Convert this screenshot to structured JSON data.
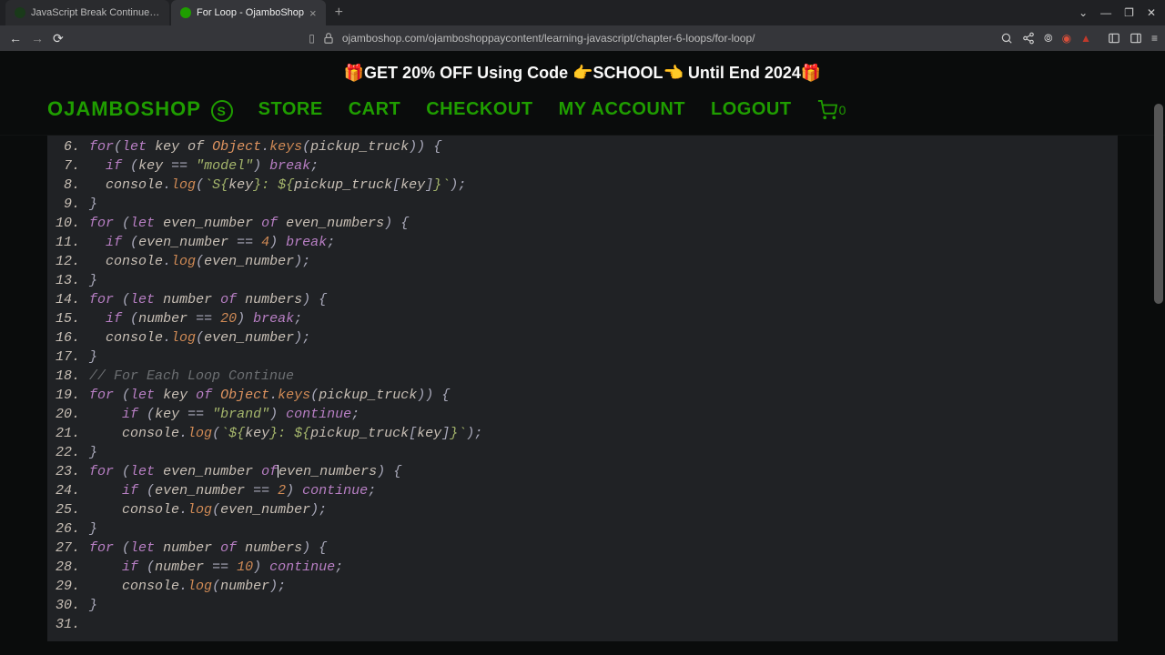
{
  "tabs": [
    {
      "title": "JavaScript Break Continue Loo…",
      "active": false
    },
    {
      "title": "For Loop - OjamboShop",
      "active": true
    }
  ],
  "url": "ojamboshop.com/ojamboshoppaycontent/learning-javascript/chapter-6-loops/for-loop/",
  "promo": "🎁GET 20% OFF Using Code 👉SCHOOL👈 Until End 2024🎁",
  "nav": {
    "brand": "OJAMBOSHOP",
    "store": "STORE",
    "cart": "CART",
    "checkout": "CHECKOUT",
    "account": "MY ACCOUNT",
    "logout": "LOGOUT",
    "cart_count": "0"
  },
  "code": [
    {
      "n": "6.",
      "segs": [
        [
          "kw",
          "for"
        ],
        [
          "punct",
          "("
        ],
        [
          "kw",
          "let"
        ],
        [
          "",
          "",
          " "
        ],
        [
          "",
          "key of "
        ],
        [
          "obj",
          "Object"
        ],
        [
          "punct",
          "."
        ],
        [
          "fn",
          "keys"
        ],
        [
          "punct",
          "("
        ],
        [
          "",
          "pickup_truck"
        ],
        [
          "punct",
          "))"
        ],
        [
          "",
          "",
          " "
        ],
        [
          "punct",
          "{"
        ]
      ]
    },
    {
      "n": "7.",
      "segs": [
        [
          "",
          "  "
        ],
        [
          "kw",
          "if"
        ],
        [
          "",
          "",
          " "
        ],
        [
          "punct",
          "("
        ],
        [
          "",
          "key "
        ],
        [
          "punct",
          "=="
        ],
        [
          "",
          "",
          " "
        ],
        [
          "str",
          "\"model\""
        ],
        [
          "punct",
          ")"
        ],
        [
          "",
          "",
          " "
        ],
        [
          "kw",
          "break"
        ],
        [
          "punct",
          ";"
        ]
      ]
    },
    {
      "n": "8.",
      "segs": [
        [
          "",
          "  "
        ],
        [
          "",
          "console"
        ],
        [
          "punct",
          "."
        ],
        [
          "fn",
          "log"
        ],
        [
          "punct",
          "("
        ],
        [
          "str",
          "`S{"
        ],
        [
          "",
          "key"
        ],
        [
          "str",
          "}: ${"
        ],
        [
          "",
          "pickup_truck"
        ],
        [
          "punct",
          "["
        ],
        [
          "",
          "key"
        ],
        [
          "punct",
          "]"
        ],
        [
          "str",
          "}`"
        ],
        [
          "punct",
          ");"
        ]
      ]
    },
    {
      "n": "9.",
      "segs": [
        [
          "punct",
          "}"
        ]
      ]
    },
    {
      "n": "10.",
      "segs": [
        [
          "kw",
          "for"
        ],
        [
          "",
          "",
          " "
        ],
        [
          "punct",
          "("
        ],
        [
          "kw",
          "let"
        ],
        [
          "",
          "",
          " "
        ],
        [
          "",
          "even_number "
        ],
        [
          "kw",
          "of"
        ],
        [
          "",
          "",
          " "
        ],
        [
          "",
          "even_numbers"
        ],
        [
          "punct",
          ")"
        ],
        [
          "",
          "",
          " "
        ],
        [
          "punct",
          "{"
        ]
      ]
    },
    {
      "n": "11.",
      "segs": [
        [
          "",
          "  "
        ],
        [
          "kw",
          "if"
        ],
        [
          "",
          "",
          " "
        ],
        [
          "punct",
          "("
        ],
        [
          "",
          "even_number "
        ],
        [
          "punct",
          "=="
        ],
        [
          "",
          "",
          " "
        ],
        [
          "num",
          "4"
        ],
        [
          "punct",
          ")"
        ],
        [
          "",
          "",
          " "
        ],
        [
          "kw",
          "break"
        ],
        [
          "punct",
          ";"
        ]
      ]
    },
    {
      "n": "12.",
      "segs": [
        [
          "",
          "  "
        ],
        [
          "",
          "console"
        ],
        [
          "punct",
          "."
        ],
        [
          "fn",
          "log"
        ],
        [
          "punct",
          "("
        ],
        [
          "",
          "even_number"
        ],
        [
          "punct",
          ");"
        ]
      ]
    },
    {
      "n": "13.",
      "segs": [
        [
          "punct",
          "}"
        ]
      ]
    },
    {
      "n": "14.",
      "segs": [
        [
          "kw",
          "for"
        ],
        [
          "",
          "",
          " "
        ],
        [
          "punct",
          "("
        ],
        [
          "kw",
          "let"
        ],
        [
          "",
          "",
          " "
        ],
        [
          "",
          "number "
        ],
        [
          "kw",
          "of"
        ],
        [
          "",
          "",
          " "
        ],
        [
          "",
          "numbers"
        ],
        [
          "punct",
          ")"
        ],
        [
          "",
          "",
          " "
        ],
        [
          "punct",
          "{"
        ]
      ]
    },
    {
      "n": "15.",
      "segs": [
        [
          "",
          "  "
        ],
        [
          "kw",
          "if"
        ],
        [
          "",
          "",
          " "
        ],
        [
          "punct",
          "("
        ],
        [
          "",
          "number "
        ],
        [
          "punct",
          "=="
        ],
        [
          "",
          "",
          " "
        ],
        [
          "num",
          "20"
        ],
        [
          "punct",
          ")"
        ],
        [
          "",
          "",
          " "
        ],
        [
          "kw",
          "break"
        ],
        [
          "punct",
          ";"
        ]
      ]
    },
    {
      "n": "16.",
      "segs": [
        [
          "",
          "  "
        ],
        [
          "",
          "console"
        ],
        [
          "punct",
          "."
        ],
        [
          "fn",
          "log"
        ],
        [
          "punct",
          "("
        ],
        [
          "",
          "even_number"
        ],
        [
          "punct",
          ");"
        ]
      ]
    },
    {
      "n": "17.",
      "segs": [
        [
          "punct",
          "}"
        ]
      ]
    },
    {
      "n": "18.",
      "segs": [
        [
          "comment",
          "// For Each Loop Continue"
        ]
      ]
    },
    {
      "n": "19.",
      "segs": [
        [
          "kw",
          "for"
        ],
        [
          "",
          "",
          " "
        ],
        [
          "punct",
          "("
        ],
        [
          "kw",
          "let"
        ],
        [
          "",
          "",
          " "
        ],
        [
          "",
          "key "
        ],
        [
          "kw",
          "of"
        ],
        [
          "",
          "",
          " "
        ],
        [
          "obj",
          "Object"
        ],
        [
          "punct",
          "."
        ],
        [
          "fn",
          "keys"
        ],
        [
          "punct",
          "("
        ],
        [
          "",
          "pickup_truck"
        ],
        [
          "punct",
          "))"
        ],
        [
          "",
          "",
          " "
        ],
        [
          "punct",
          "{"
        ]
      ]
    },
    {
      "n": "20.",
      "segs": [
        [
          "",
          "    "
        ],
        [
          "kw",
          "if"
        ],
        [
          "",
          "",
          " "
        ],
        [
          "punct",
          "("
        ],
        [
          "",
          "key "
        ],
        [
          "punct",
          "=="
        ],
        [
          "",
          "",
          " "
        ],
        [
          "str",
          "\"brand\""
        ],
        [
          "punct",
          ")"
        ],
        [
          "",
          "",
          " "
        ],
        [
          "kw",
          "continue"
        ],
        [
          "punct",
          ";"
        ]
      ]
    },
    {
      "n": "21.",
      "segs": [
        [
          "",
          "    "
        ],
        [
          "",
          "console"
        ],
        [
          "punct",
          "."
        ],
        [
          "fn",
          "log"
        ],
        [
          "punct",
          "("
        ],
        [
          "str",
          "`${"
        ],
        [
          "",
          "key"
        ],
        [
          "str",
          "}: ${"
        ],
        [
          "",
          "pickup_truck"
        ],
        [
          "punct",
          "["
        ],
        [
          "",
          "key"
        ],
        [
          "punct",
          "]"
        ],
        [
          "str",
          "}`"
        ],
        [
          "punct",
          ");"
        ]
      ]
    },
    {
      "n": "22.",
      "segs": [
        [
          "punct",
          "}"
        ]
      ]
    },
    {
      "n": "23.",
      "segs": [
        [
          "kw",
          "for"
        ],
        [
          "",
          "",
          " "
        ],
        [
          "punct",
          "("
        ],
        [
          "kw",
          "let"
        ],
        [
          "",
          "",
          " "
        ],
        [
          "",
          "even_number "
        ],
        [
          "kw",
          "of"
        ],
        [
          "cursor",
          ""
        ],
        [
          "",
          "even_numbers"
        ],
        [
          "punct",
          ")"
        ],
        [
          "",
          "",
          " "
        ],
        [
          "punct",
          "{"
        ]
      ]
    },
    {
      "n": "24.",
      "segs": [
        [
          "",
          "    "
        ],
        [
          "kw",
          "if"
        ],
        [
          "",
          "",
          " "
        ],
        [
          "punct",
          "("
        ],
        [
          "",
          "even_number "
        ],
        [
          "punct",
          "=="
        ],
        [
          "",
          "",
          " "
        ],
        [
          "num",
          "2"
        ],
        [
          "punct",
          ")"
        ],
        [
          "",
          "",
          " "
        ],
        [
          "kw",
          "continue"
        ],
        [
          "punct",
          ";"
        ]
      ]
    },
    {
      "n": "25.",
      "segs": [
        [
          "",
          "    "
        ],
        [
          "",
          "console"
        ],
        [
          "punct",
          "."
        ],
        [
          "fn",
          "log"
        ],
        [
          "punct",
          "("
        ],
        [
          "",
          "even_number"
        ],
        [
          "punct",
          ");"
        ]
      ]
    },
    {
      "n": "26.",
      "segs": [
        [
          "punct",
          "}"
        ]
      ]
    },
    {
      "n": "27.",
      "segs": [
        [
          "kw",
          "for"
        ],
        [
          "",
          "",
          " "
        ],
        [
          "punct",
          "("
        ],
        [
          "kw",
          "let"
        ],
        [
          "",
          "",
          " "
        ],
        [
          "",
          "number "
        ],
        [
          "kw",
          "of"
        ],
        [
          "",
          "",
          " "
        ],
        [
          "",
          "numbers"
        ],
        [
          "punct",
          ")"
        ],
        [
          "",
          "",
          " "
        ],
        [
          "punct",
          "{"
        ]
      ]
    },
    {
      "n": "28.",
      "segs": [
        [
          "",
          "    "
        ],
        [
          "kw",
          "if"
        ],
        [
          "",
          "",
          " "
        ],
        [
          "punct",
          "("
        ],
        [
          "",
          "number "
        ],
        [
          "punct",
          "=="
        ],
        [
          "",
          "",
          " "
        ],
        [
          "num",
          "10"
        ],
        [
          "punct",
          ")"
        ],
        [
          "",
          "",
          " "
        ],
        [
          "kw",
          "continue"
        ],
        [
          "punct",
          ";"
        ]
      ]
    },
    {
      "n": "29.",
      "segs": [
        [
          "",
          "    "
        ],
        [
          "",
          "console"
        ],
        [
          "punct",
          "."
        ],
        [
          "fn",
          "log"
        ],
        [
          "punct",
          "("
        ],
        [
          "",
          "number"
        ],
        [
          "punct",
          ");"
        ]
      ]
    },
    {
      "n": "30.",
      "segs": [
        [
          "punct",
          "}"
        ]
      ]
    },
    {
      "n": "31.",
      "segs": [
        [
          "",
          ""
        ]
      ]
    }
  ]
}
